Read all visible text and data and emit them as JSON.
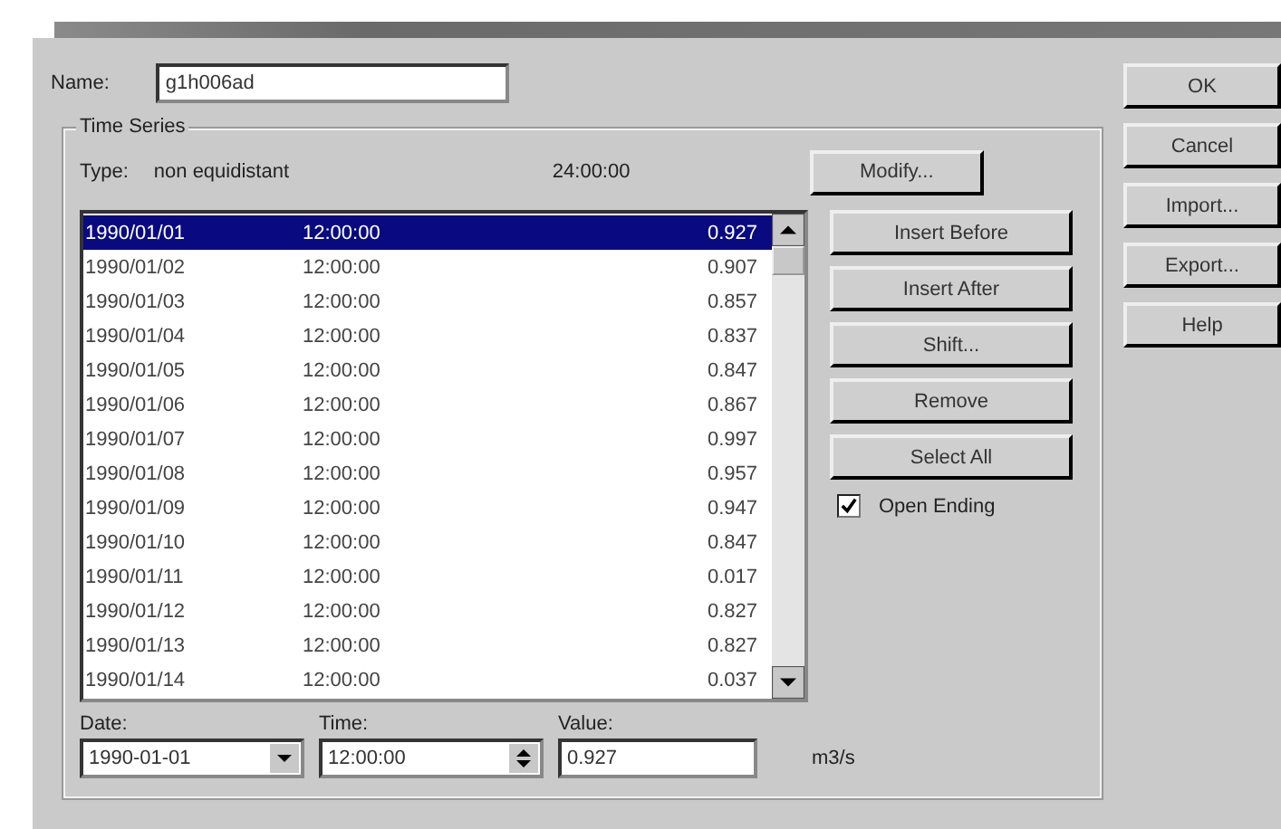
{
  "name": {
    "label": "Name:",
    "value": "g1h006ad"
  },
  "time_series": {
    "title": "Time Series",
    "type_label": "Type:",
    "type_value": "non equidistant",
    "interval": "24:00:00",
    "rows": [
      {
        "date": "1990/01/01",
        "time": "12:00:00",
        "value": "0.927",
        "selected": true
      },
      {
        "date": "1990/01/02",
        "time": "12:00:00",
        "value": "0.907",
        "selected": false
      },
      {
        "date": "1990/01/03",
        "time": "12:00:00",
        "value": "0.857",
        "selected": false
      },
      {
        "date": "1990/01/04",
        "time": "12:00:00",
        "value": "0.837",
        "selected": false
      },
      {
        "date": "1990/01/05",
        "time": "12:00:00",
        "value": "0.847",
        "selected": false
      },
      {
        "date": "1990/01/06",
        "time": "12:00:00",
        "value": "0.867",
        "selected": false
      },
      {
        "date": "1990/01/07",
        "time": "12:00:00",
        "value": "0.997",
        "selected": false
      },
      {
        "date": "1990/01/08",
        "time": "12:00:00",
        "value": "0.957",
        "selected": false
      },
      {
        "date": "1990/01/09",
        "time": "12:00:00",
        "value": "0.947",
        "selected": false
      },
      {
        "date": "1990/01/10",
        "time": "12:00:00",
        "value": "0.847",
        "selected": false
      },
      {
        "date": "1990/01/11",
        "time": "12:00:00",
        "value": "0.017",
        "selected": false
      },
      {
        "date": "1990/01/12",
        "time": "12:00:00",
        "value": "0.827",
        "selected": false
      },
      {
        "date": "1990/01/13",
        "time": "12:00:00",
        "value": "0.827",
        "selected": false
      },
      {
        "date": "1990/01/14",
        "time": "12:00:00",
        "value": "0.037",
        "selected": false
      }
    ],
    "modify_button": "Modify...",
    "action_buttons": [
      "Insert Before",
      "Insert After",
      "Shift...",
      "Remove",
      "Select All"
    ],
    "open_ending": {
      "label": "Open Ending",
      "checked": true
    },
    "date": {
      "label": "Date:",
      "value": "1990-01-01"
    },
    "time": {
      "label": "Time:",
      "value": "12:00:00"
    },
    "value": {
      "label": "Value:",
      "value": "0.927",
      "unit": "m3/s"
    }
  },
  "dialog_buttons": [
    "OK",
    "Cancel",
    "Import...",
    "Export...",
    "Help"
  ]
}
